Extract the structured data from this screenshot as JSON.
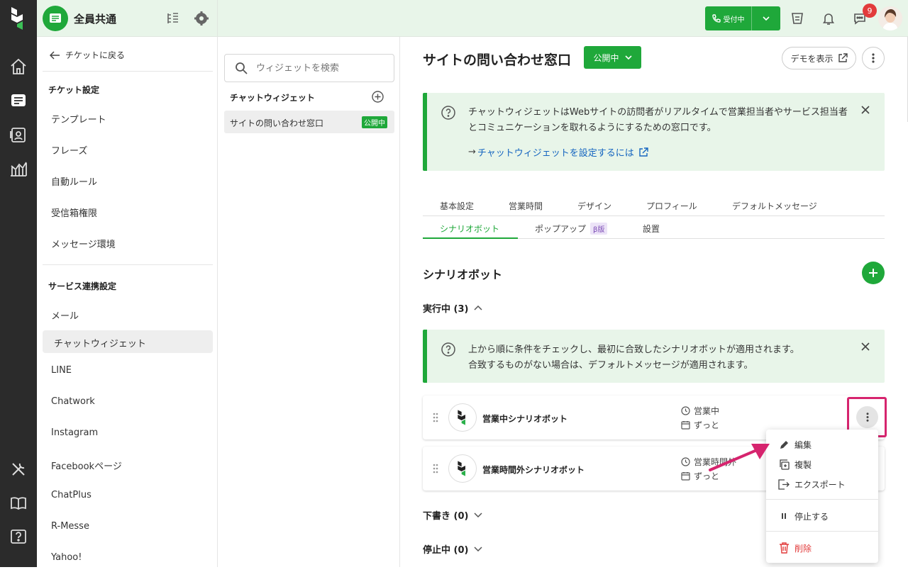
{
  "app": {
    "workspace": "全員共通"
  },
  "topbar": {
    "status_label": "受付中",
    "notification_count": "9"
  },
  "sidebar": {
    "back": "チケットに戻る",
    "section1": "チケット設定",
    "items1": [
      "テンプレート",
      "フレーズ",
      "自動ルール",
      "受信箱権限",
      "メッセージ環境"
    ],
    "section2": "サービス連携設定",
    "items2": [
      "メール",
      "チャットウィジェット",
      "LINE",
      "Chatwork",
      "Instagram",
      "Facebookページ",
      "ChatPlus",
      "R-Messe",
      "Yahoo!"
    ]
  },
  "widgets": {
    "search_placeholder": "ウィジェットを検索",
    "heading": "チャットウィジェット",
    "item_name": "サイトの問い合わせ窓口",
    "item_badge": "公開中"
  },
  "main": {
    "title": "サイトの問い合わせ窓口",
    "status_button": "公開中",
    "demo_button": "デモを表示",
    "info": {
      "text": "チャットウィジェットはWebサイトの訪問者がリアルタイムで営業担当者やサービス担当者とコミュニケーションを取れるようにするための窓口です。",
      "link": "チャットウィジェットを設定するには"
    },
    "tabs_row1": [
      "基本設定",
      "営業時間",
      "デザイン",
      "プロフィール",
      "デフォルトメッセージ"
    ],
    "tabs_row2": {
      "active": "シナリオボット",
      "popup": "ポップアップ",
      "beta": "β版",
      "setup": "設置"
    },
    "section_title": "シナリオボット",
    "running": "実行中 (3)",
    "info2": {
      "line1": "上から順に条件をチェックし、最初に合致したシナリオボットが適用されます。",
      "line2": "合致するものがない場合は、デフォルトメッセージが適用されます。"
    },
    "bots": [
      {
        "name": "営業中シナリオボット",
        "hours": "営業中",
        "period": "ずっと"
      },
      {
        "name": "営業時間外シナリオボット",
        "hours": "営業時間外",
        "period": "ずっと"
      }
    ],
    "drafts": "下書き (0)",
    "stopped": "停止中 (0)"
  },
  "menu": {
    "edit": "編集",
    "duplicate": "複製",
    "export": "エクスポート",
    "stop": "停止する",
    "delete": "削除"
  },
  "colors": {
    "accent": "#1fa83a",
    "highlight": "#d6246e",
    "danger": "#e23b3b",
    "link": "#1565c0"
  }
}
